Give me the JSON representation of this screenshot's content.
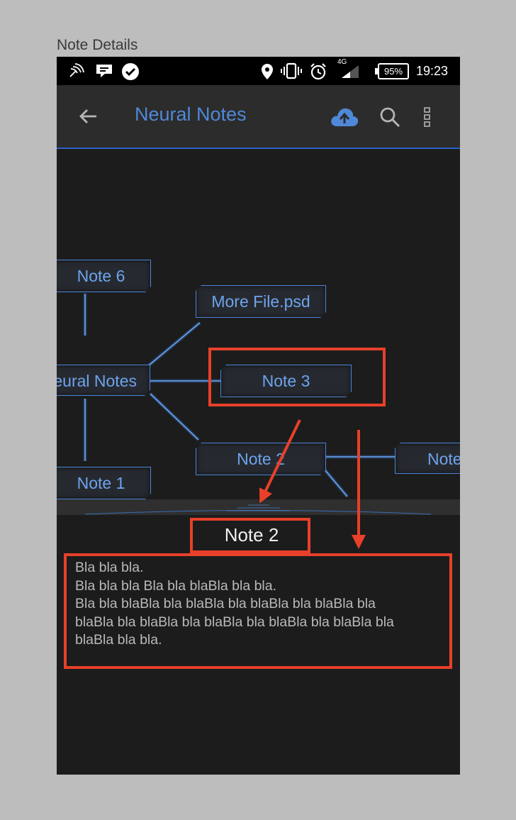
{
  "page_caption": "Note Details",
  "status_bar": {
    "network": "4G",
    "battery": "95%",
    "time": "19:23"
  },
  "toolbar": {
    "title": "Neural Notes",
    "icons": [
      "back-arrow-icon",
      "cloud-upload-icon",
      "search-icon",
      "more-vert-icon"
    ]
  },
  "mindmap": {
    "nodes": {
      "note6": "Note 6",
      "more_file": "More File.psd",
      "root": "Neural Notes",
      "note3": "Note 3",
      "note2": "Note 2",
      "note1": "Note 1",
      "note_right": "Note"
    }
  },
  "note_detail": {
    "title": "Note 2",
    "body_lines": [
      "Bla bla bla.",
      "Bla bla bla Bla bla blaBla bla bla.",
      "Bla bla blaBla bla blaBla bla blaBla bla blaBla bla",
      "blaBla bla blaBla bla blaBla bla blaBla bla blaBla bla",
      "blaBla bla bla."
    ]
  },
  "colors": {
    "accent": "#4f88d8",
    "annotation": "#e8402a",
    "background": "#1c1c1c",
    "toolbar": "#2c2c2c"
  }
}
